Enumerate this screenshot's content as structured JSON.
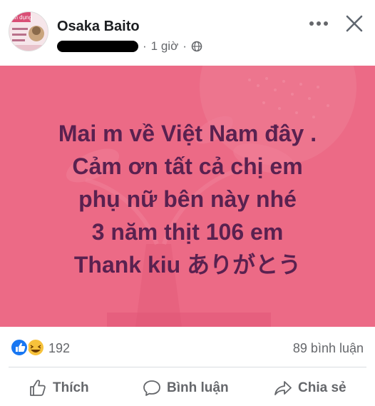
{
  "post": {
    "author": "Osaka Baito",
    "time": "1 giờ",
    "separator": "·",
    "audience_icon": "globe-icon",
    "avatar_text": "ân dụng",
    "message": "Mai m về Việt Nam đây .\nCảm ơn tất cả chị em\nphụ nữ bên này nhé\n3 năm thịt 106  em\nThank kiu  ありがとう",
    "background_color": "#ec6a86",
    "text_color": "#5a2150"
  },
  "header": {
    "more_icon": "more-options-icon",
    "close_icon": "close-icon"
  },
  "stats": {
    "reaction_icons": [
      "like-icon",
      "haha-icon"
    ],
    "reaction_count": "192",
    "comment_count": "89 bình luận"
  },
  "actions": {
    "like": "Thích",
    "comment": "Bình luận",
    "share": "Chia sẻ"
  },
  "colors": {
    "like_blue": "#1877f2",
    "haha_yellow": "#f7c23b",
    "secondary_text": "#65676b"
  }
}
